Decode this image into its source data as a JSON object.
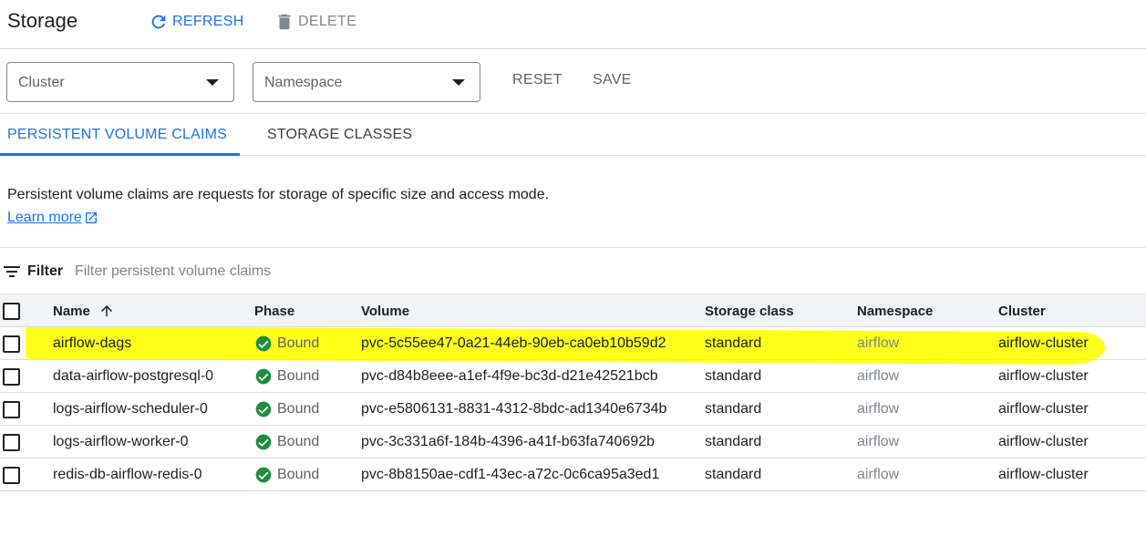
{
  "header": {
    "title": "Storage",
    "refresh_label": "REFRESH",
    "delete_label": "DELETE"
  },
  "filters": {
    "cluster_label": "Cluster",
    "namespace_label": "Namespace",
    "reset_label": "RESET",
    "save_label": "SAVE"
  },
  "tabs": [
    {
      "label": "PERSISTENT VOLUME CLAIMS",
      "active": true
    },
    {
      "label": "STORAGE CLASSES",
      "active": false
    }
  ],
  "description": {
    "text": "Persistent volume claims are requests for storage of specific size and access mode.",
    "learn_more": "Learn more"
  },
  "filterbar": {
    "label": "Filter",
    "placeholder": "Filter persistent volume claims"
  },
  "table": {
    "columns": {
      "name": "Name",
      "phase": "Phase",
      "volume": "Volume",
      "storage_class": "Storage class",
      "namespace": "Namespace",
      "cluster": "Cluster"
    },
    "rows": [
      {
        "name": "airflow-dags",
        "phase": "Bound",
        "volume": "pvc-5c55ee47-0a21-44eb-90eb-ca0eb10b59d2",
        "storage_class": "standard",
        "namespace": "airflow",
        "cluster": "airflow-cluster"
      },
      {
        "name": "data-airflow-postgresql-0",
        "phase": "Bound",
        "volume": "pvc-d84b8eee-a1ef-4f9e-bc3d-d21e42521bcb",
        "storage_class": "standard",
        "namespace": "airflow",
        "cluster": "airflow-cluster"
      },
      {
        "name": "logs-airflow-scheduler-0",
        "phase": "Bound",
        "volume": "pvc-e5806131-8831-4312-8bdc-ad1340e6734b",
        "storage_class": "standard",
        "namespace": "airflow",
        "cluster": "airflow-cluster"
      },
      {
        "name": "logs-airflow-worker-0",
        "phase": "Bound",
        "volume": "pvc-3c331a6f-184b-4396-a41f-b63fa740692b",
        "storage_class": "standard",
        "namespace": "airflow",
        "cluster": "airflow-cluster"
      },
      {
        "name": "redis-db-airflow-redis-0",
        "phase": "Bound",
        "volume": "pvc-8b8150ae-cdf1-43ec-a72c-0c6ca95a3ed1",
        "storage_class": "standard",
        "namespace": "airflow",
        "cluster": "airflow-cluster"
      }
    ]
  },
  "colors": {
    "accent": "#1a73e8",
    "bound_green": "#1e8e3e",
    "highlight": "#ffff00"
  },
  "icons": {
    "refresh": "refresh-icon",
    "delete": "trash-icon",
    "dropdown": "caret-down-icon",
    "external": "external-link-icon",
    "filter": "filter-icon",
    "sort": "arrow-up-icon",
    "status": "check-circle-icon"
  }
}
